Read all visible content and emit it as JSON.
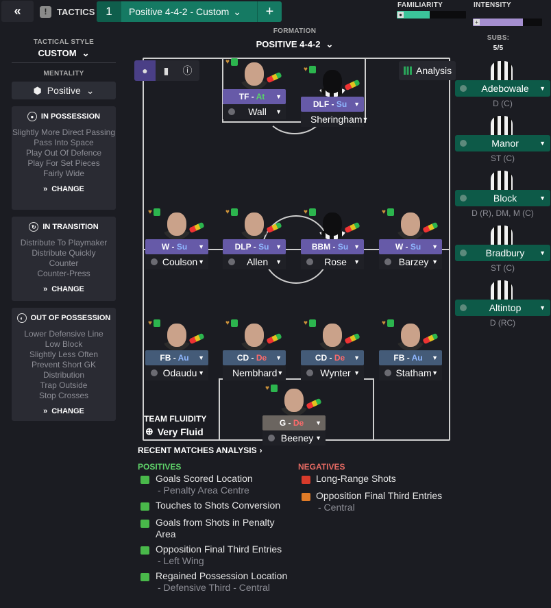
{
  "topbar": {
    "back": "«",
    "tactics_label": "TACTICS",
    "tactic_number": "1",
    "tactic_name": "Positive 4-4-2 - Custom",
    "add": "+",
    "familiarity_label": "FAMILIARITY",
    "familiarity_value": 0.48,
    "familiarity_color": "#3bc49a",
    "intensity_label": "INTENSITY",
    "intensity_value": 0.72,
    "intensity_color": "#a58fd0"
  },
  "sidebar": {
    "style_label": "TACTICAL STYLE",
    "style_value": "CUSTOM",
    "mentality_label": "MENTALITY",
    "mentality_value": "Positive",
    "in_possession": {
      "title": "IN POSSESSION",
      "items": [
        "Slightly More Direct Passing",
        "Pass Into Space",
        "Play Out Of Defence",
        "Play For Set Pieces",
        "Fairly Wide"
      ],
      "change": "CHANGE"
    },
    "in_transition": {
      "title": "IN TRANSITION",
      "items": [
        "Distribute To Playmaker",
        "Distribute Quickly",
        "Counter",
        "Counter-Press"
      ],
      "change": "CHANGE"
    },
    "out_of_possession": {
      "title": "OUT OF POSSESSION",
      "items": [
        "Lower Defensive Line",
        "Low Block",
        "Slightly Less Often",
        "Prevent Short GK Distribution",
        "Trap Outside",
        "Stop Crosses"
      ],
      "change": "CHANGE"
    }
  },
  "formation": {
    "label": "FORMATION",
    "value": "POSITIVE 4-4-2",
    "analysis_button": "Analysis"
  },
  "players": [
    {
      "role": "TF",
      "duty": "At",
      "name": "Wall",
      "silhouette": false
    },
    {
      "role": "DLF",
      "duty": "Su",
      "name": "Sheringham",
      "silhouette": true
    },
    {
      "role": "W",
      "duty": "Su",
      "name": "Coulson",
      "silhouette": false
    },
    {
      "role": "DLP",
      "duty": "Su",
      "name": "Allen",
      "silhouette": false
    },
    {
      "role": "BBM",
      "duty": "Su",
      "name": "Rose",
      "silhouette": true
    },
    {
      "role": "W",
      "duty": "Su",
      "name": "Barzey",
      "silhouette": false
    },
    {
      "role": "FB",
      "duty": "Au",
      "name": "Odaudu",
      "silhouette": false
    },
    {
      "role": "CD",
      "duty": "De",
      "name": "Nembhard",
      "silhouette": false
    },
    {
      "role": "CD",
      "duty": "De",
      "name": "Wynter",
      "silhouette": false
    },
    {
      "role": "FB",
      "duty": "Au",
      "name": "Statham",
      "silhouette": false
    },
    {
      "role": "G",
      "duty": "De",
      "name": "Beeney",
      "silhouette": false
    }
  ],
  "team_fluidity": {
    "label": "TEAM FLUIDITY",
    "value": "Very Fluid"
  },
  "subs": {
    "label": "SUBS:",
    "count": "5/5",
    "players": [
      {
        "name": "Adebowale",
        "pos": "D (C)"
      },
      {
        "name": "Manor",
        "pos": "ST (C)"
      },
      {
        "name": "Block",
        "pos": "D (R), DM, M (C)"
      },
      {
        "name": "Bradbury",
        "pos": "ST (C)"
      },
      {
        "name": "Altintop",
        "pos": "D (RC)"
      }
    ]
  },
  "analysis": {
    "title": "RECENT MATCHES ANALYSIS",
    "positives_label": "POSITIVES",
    "negatives_label": "NEGATIVES",
    "positives": [
      {
        "text": "Goals Scored Location",
        "detail": "- Penalty Area Centre"
      },
      {
        "text": "Touches to Shots Conversion",
        "detail": ""
      },
      {
        "text": "Goals from Shots in Penalty Area",
        "detail": ""
      },
      {
        "text": "Opposition Final Third Entries",
        "detail": "- Left Wing"
      },
      {
        "text": "Regained Possession Location",
        "detail": "- Defensive Third - Central"
      }
    ],
    "negatives": [
      {
        "text": "Long-Range Shots",
        "detail": ""
      },
      {
        "text": "Opposition Final Third Entries",
        "detail": "- Central"
      }
    ]
  }
}
